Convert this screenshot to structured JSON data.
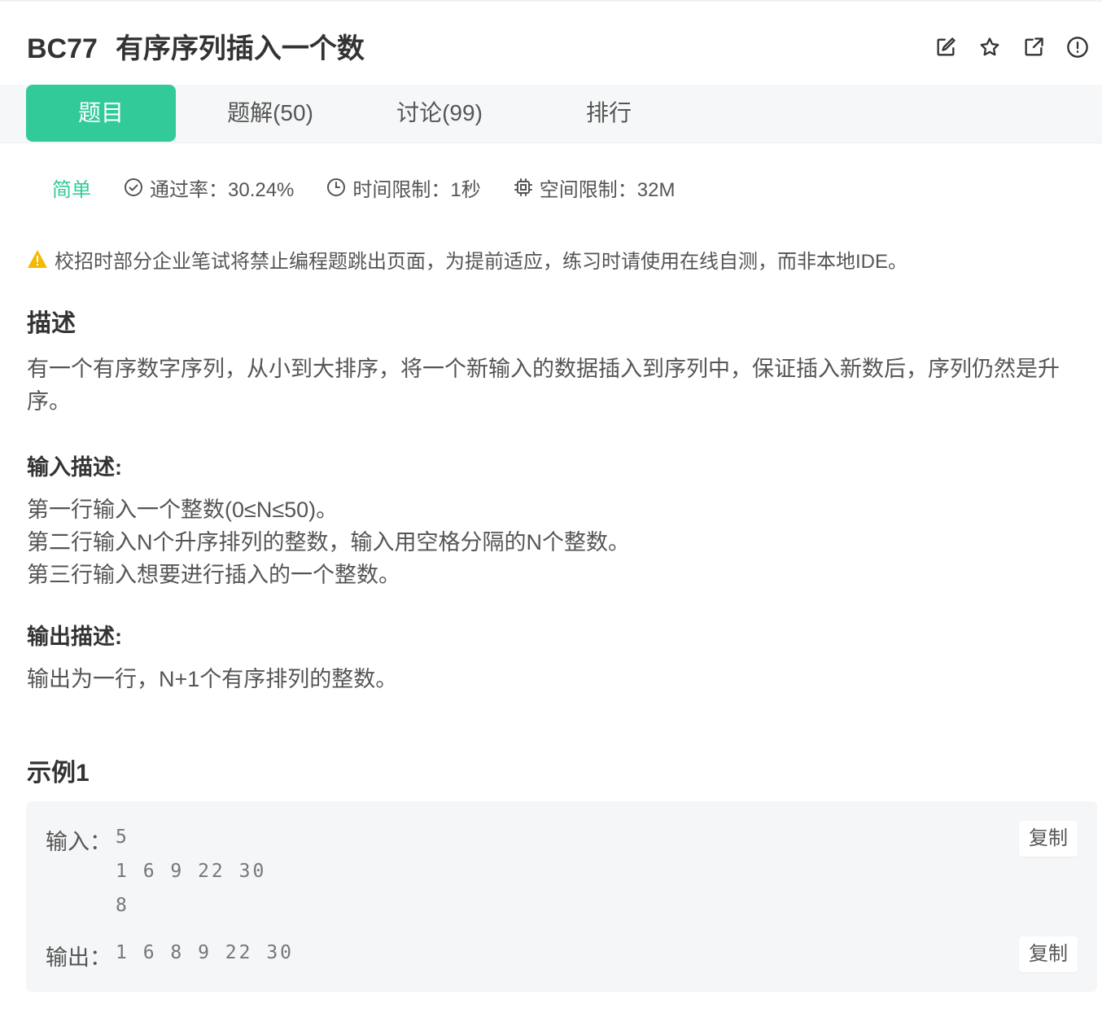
{
  "problem": {
    "code": "BC77",
    "title": "有序序列插入一个数"
  },
  "actions": {
    "edit_icon": "edit-icon",
    "star_icon": "star-icon",
    "share_icon": "external-link-icon",
    "report_icon": "alert-circle-icon"
  },
  "tabs": [
    {
      "label": "题目",
      "active": true
    },
    {
      "label": "题解(50)",
      "active": false
    },
    {
      "label": "讨论(99)",
      "active": false
    },
    {
      "label": "排行",
      "active": false
    }
  ],
  "meta": {
    "level": "简单",
    "pass_rate": "通过率：30.24%",
    "time_limit": "时间限制：1秒",
    "memory_limit": "空间限制：32M"
  },
  "notice": "校招时部分企业笔试将禁止编程题跳出页面，为提前适应，练习时请使用在线自测，而非本地IDE。",
  "description": {
    "heading": "描述",
    "lines": [
      "有一个有序数字序列，从小到大排序，将一个新输入的数据插入到序列中，保证插入新数后，序列仍然是升",
      "序。"
    ]
  },
  "input_desc": {
    "heading": "输入描述:",
    "lines": [
      "第一行输入一个整数(0≤N≤50)。",
      "第二行输入N个升序排列的整数，输入用空格分隔的N个整数。",
      "第三行输入想要进行插入的一个整数。"
    ]
  },
  "output_desc": {
    "heading": "输出描述:",
    "lines": [
      "输出为一行，N+1个有序排列的整数。"
    ]
  },
  "example": {
    "heading": "示例1",
    "input_label": "输入：",
    "input_lines": [
      "5",
      "1 6 9 22 30",
      "8"
    ],
    "output_label": "输出：",
    "output_line": "1 6 8 9 22 30",
    "copy_label": "复制"
  },
  "colors": {
    "accent": "#32ca99",
    "warning": "#f5b800"
  }
}
